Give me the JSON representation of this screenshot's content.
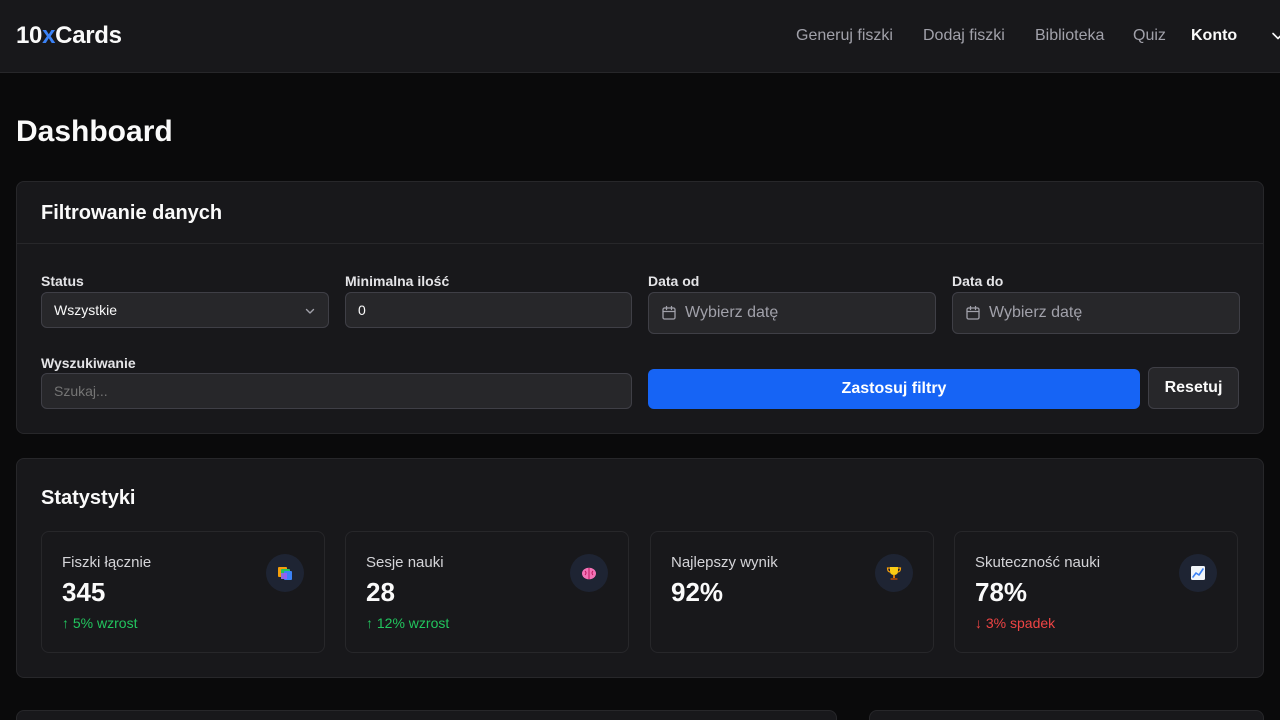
{
  "navbar": {
    "logo": {
      "prefix": "10",
      "accent": "x",
      "suffix": "Cards"
    },
    "links": [
      "Generuj fiszki",
      "Dodaj fiszki",
      "Biblioteka",
      "Quiz"
    ],
    "account_label": "Konto"
  },
  "page_title": "Dashboard",
  "filters": {
    "title": "Filtrowanie danych",
    "status_label": "Status",
    "status_value": "Wszystkie",
    "min_count_label": "Minimalna ilość",
    "min_count_value": "0",
    "date_from_label": "Data od",
    "date_from_placeholder": "Wybierz datę",
    "date_to_label": "Data do",
    "date_to_placeholder": "Wybierz datę",
    "search_label": "Wyszukiwanie",
    "search_placeholder": "Szukaj...",
    "apply_button": "Zastosuj filtry",
    "reset_button": "Resetuj"
  },
  "stats": {
    "title": "Statystyki",
    "items": [
      {
        "label": "Fiszki łącznie",
        "value": "345",
        "trend": "↑ 5% wzrost",
        "trend_dir": "up",
        "icon": "cards-icon"
      },
      {
        "label": "Sesje nauki",
        "value": "28",
        "trend": "↑ 12% wzrost",
        "trend_dir": "up",
        "icon": "brain-icon"
      },
      {
        "label": "Najlepszy wynik",
        "value": "92%",
        "trend": "",
        "trend_dir": "none",
        "icon": "trophy-icon"
      },
      {
        "label": "Skuteczność nauki",
        "value": "78%",
        "trend": "↓ 3% spadek",
        "trend_dir": "down",
        "icon": "chart-up-icon"
      }
    ]
  },
  "colors": {
    "background": "#0a0a0b",
    "surface": "#18181b",
    "accent": "#1664f5",
    "logo_accent": "#3b82f6",
    "trend_up": "#22c55e",
    "trend_down": "#ef4444"
  }
}
